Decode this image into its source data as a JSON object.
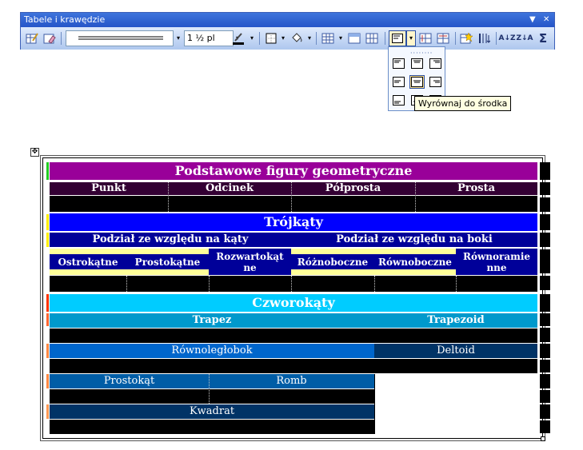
{
  "toolbar": {
    "title": "Tabele i krawędzie",
    "title_controls": {
      "menu": "▼",
      "close": "✕"
    },
    "line_weight": "1 ½ pl",
    "dropdown_arrow": "▾",
    "icons": {
      "draw_table": "pencil-table-icon",
      "eraser": "eraser-icon",
      "line_style": "line-style-icon",
      "border_color": "pen-color-icon",
      "borders": "outside-border-icon",
      "shading": "paint-bucket-icon",
      "insert_table": "insert-table-icon",
      "merge_cells": "merge-cells-icon",
      "split_cells": "split-cells-icon",
      "align": "align-icon",
      "distribute_rows": "distribute-rows-icon",
      "distribute_cols": "distribute-columns-icon",
      "autoformat": "table-autoformat-icon",
      "text_direction": "text-direction-icon",
      "sort_asc": "sort-ascending-icon",
      "sort_desc": "sort-descending-icon",
      "autosum": "autosum-icon"
    },
    "glyphs": {
      "sigma": "Σ",
      "az": "A↓Z",
      "za": "Z↓A"
    }
  },
  "align_palette": {
    "tooltip": "Wyrównaj do środka",
    "grip": "········",
    "selected": "middle-center"
  },
  "document": {
    "anchor_glyph": "✥",
    "title": "Podstawowe figury geometryczne",
    "row1": [
      "Punkt",
      "Odcinek",
      "Półprosta",
      "Prosta"
    ],
    "triangles_title": "Trójkąty",
    "angle_group": "Podział ze względu na kąty",
    "side_group": "Podział ze względu na boki",
    "angle_types": [
      "Ostrokątne",
      "Prostokątne",
      "Rozwartokąt ne"
    ],
    "side_types": [
      "Różnoboczne",
      "Równoboczne",
      "Równoramie nne"
    ],
    "quads_title": "Czworokąty",
    "trapez": "Trapez",
    "trapezoid": "Trapezoid",
    "parallelogram": "Równoległobok",
    "deltoid": "Deltoid",
    "rectangle": "Prostokąt",
    "rhombus": "Romb",
    "square": "Kwadrat"
  },
  "colors": {
    "purple": "#990099",
    "dark_purple": "#330033",
    "blue": "#0000ff",
    "navy": "#000099",
    "yellow": "#ffff99",
    "cyan": "#00ccff",
    "teal": "#0099cc",
    "medium_blue": "#0066cc",
    "steel_blue": "#005da6",
    "dark_navy": "#003366",
    "black": "#000000"
  }
}
